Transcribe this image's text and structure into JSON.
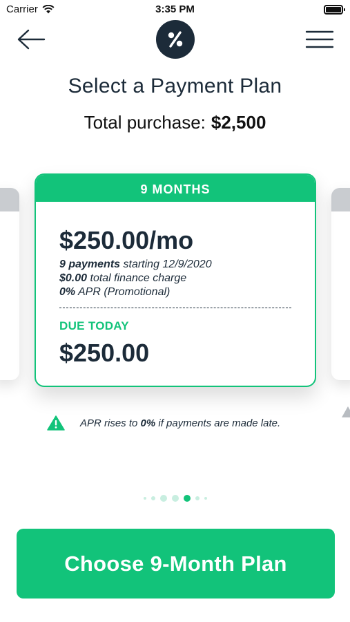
{
  "status_bar": {
    "carrier": "Carrier",
    "time": "3:35 PM"
  },
  "nav": {
    "back_icon": "arrow-left-icon",
    "logo_icon": "percent-logo-icon",
    "menu_icon": "hamburger-menu-icon"
  },
  "page": {
    "title": "Select a Payment Plan",
    "total_label": "Total purchase:",
    "total_amount": "$2,500"
  },
  "plan_card": {
    "header": "9 MONTHS",
    "monthly": "$250.00/mo",
    "payments_bold": "9 payments",
    "payments_rest": " starting 12/9/2020",
    "finance_bold": "$0.00",
    "finance_rest": " total finance charge",
    "apr_bold": "0%",
    "apr_rest": " APR (Promotional)",
    "due_label": "DUE TODAY",
    "due_amount": "$250.00"
  },
  "warning": {
    "icon": "warning-triangle-icon",
    "text_before": "APR rises to ",
    "text_bold": "0%",
    "text_after": " if payments are made late."
  },
  "pager": {
    "active_index": 4,
    "count": 7
  },
  "cta": {
    "label": "Choose 9-Month Plan"
  },
  "colors": {
    "accent": "#12c37a",
    "navy": "#1c2b39",
    "inactive_card_cap": "#c9ccd0"
  }
}
